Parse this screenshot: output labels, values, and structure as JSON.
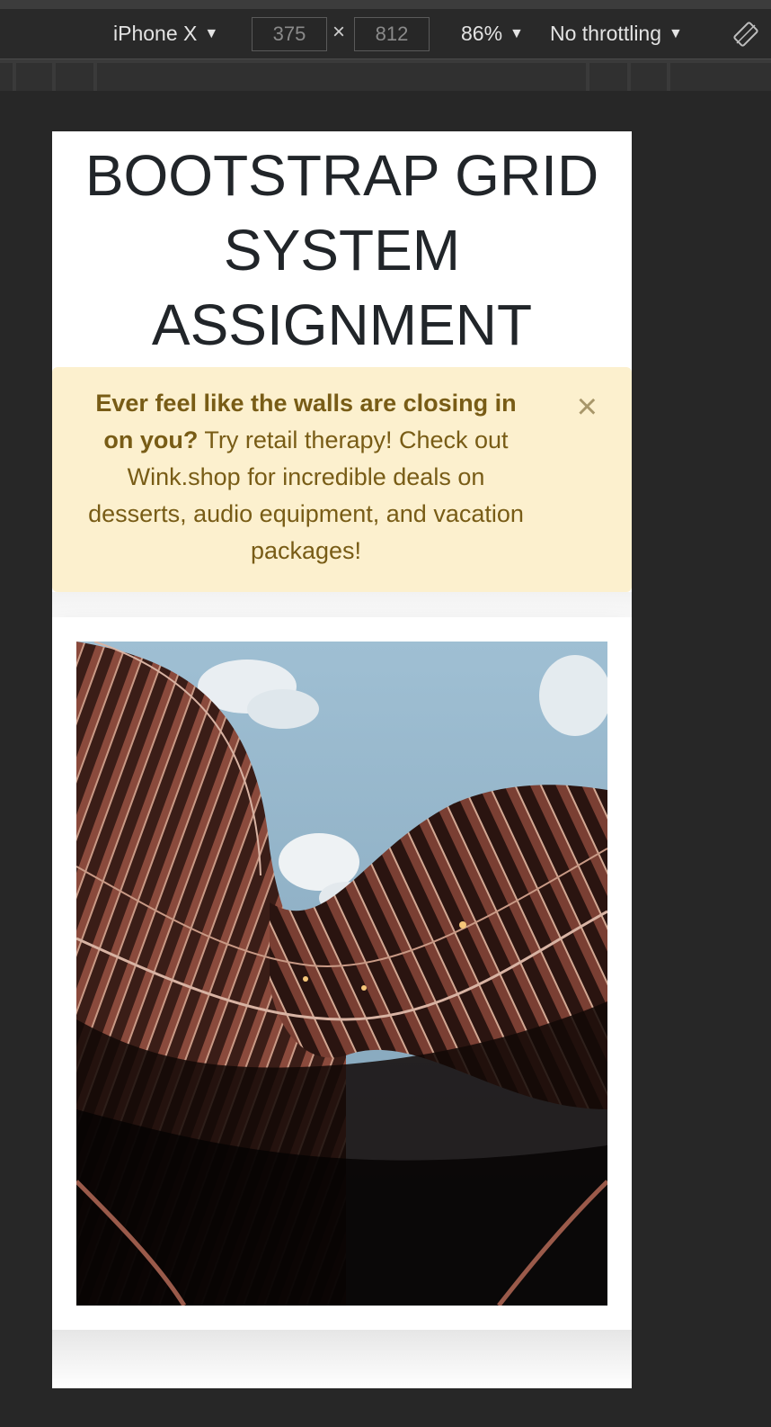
{
  "toolbar": {
    "device": "iPhone X",
    "width": "375",
    "times": "×",
    "height": "812",
    "zoom": "86%",
    "throttling": "No throttling"
  },
  "page": {
    "title": "BOOTSTRAP GRID SYSTEM ASSIGNMENT",
    "alert": {
      "bold": "Ever feel like the walls are closing in on you?",
      "text": " Try retail therapy! Check out Wink.shop for incredible deals on desserts, audio equipment, and vacation packages!",
      "close": "×"
    },
    "image_subject": "curved-modern-building-photo"
  }
}
